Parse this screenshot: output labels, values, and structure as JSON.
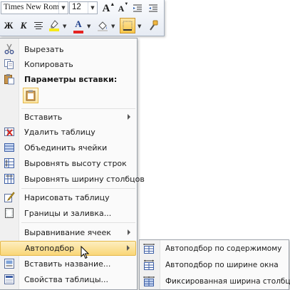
{
  "toolbar": {
    "font_name": "Times New Rom",
    "font_size": "12",
    "bold_label": "Ж",
    "italic_label": "К",
    "font_color_label": "A",
    "grow_font_label": "A",
    "shrink_font_label": "A",
    "highlight_color": "#f6ea1a",
    "font_color": "#e52421"
  },
  "menu": {
    "items": [
      {
        "label": "Вырезать",
        "icon": "scissors-icon"
      },
      {
        "label": "Копировать",
        "icon": "copy-icon"
      },
      {
        "label": "Параметры вставки:",
        "icon": "paste-icon"
      },
      {
        "label": "Вставить",
        "icon": ""
      },
      {
        "label": "Удалить таблицу",
        "icon": "delete-table-icon"
      },
      {
        "label": "Объединить ячейки",
        "icon": "merge-cells-icon"
      },
      {
        "label": "Выровнять высоту строк",
        "icon": "distribute-rows-icon"
      },
      {
        "label": "Выровнять ширину столбцов",
        "icon": "distribute-columns-icon"
      },
      {
        "label": "Нарисовать таблицу",
        "icon": "draw-table-icon"
      },
      {
        "label": "Границы и заливка...",
        "icon": "borders-shading-icon"
      },
      {
        "label": "Выравнивание ячеек",
        "icon": ""
      },
      {
        "label": "Автоподбор",
        "icon": ""
      },
      {
        "label": "Вставить название...",
        "icon": "insert-caption-icon"
      },
      {
        "label": "Свойства таблицы...",
        "icon": "table-properties-icon"
      }
    ]
  },
  "submenu": {
    "items": [
      {
        "label": "Автоподбор по содержимому",
        "icon": "autofit-contents-icon"
      },
      {
        "label": "Автоподбор по ширине окна",
        "icon": "autofit-window-icon"
      },
      {
        "label": "Фиксированная ширина столбца",
        "icon": "fixed-column-width-icon"
      }
    ]
  },
  "colors": {
    "highlight_bg": "#fbe19a",
    "highlight_border": "#e5b94c",
    "menu_bg": "#fafafa"
  }
}
